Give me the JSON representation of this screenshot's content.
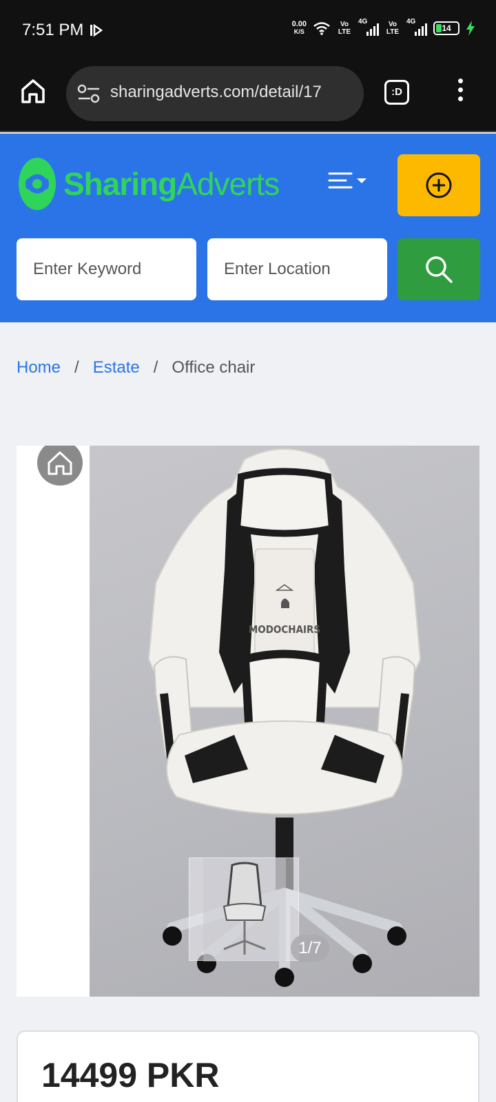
{
  "status_bar": {
    "time": "7:51 PM",
    "speed_value": "0.00",
    "speed_unit": "K/S",
    "volte1": "Vo LTE",
    "net1": "4G",
    "volte2": "Vo LTE",
    "net2": "4G",
    "battery": "14"
  },
  "browser": {
    "url": "sharingadverts.com/detail/17",
    "tab_label": ":D"
  },
  "header": {
    "brand_bold": "Sharing",
    "brand_light": "Adverts",
    "keyword_placeholder": "Enter Keyword",
    "location_placeholder": "Enter Location",
    "brand_color": "#2b74e8",
    "post_button_color": "#fdb900",
    "search_button_color": "#2f9d3f"
  },
  "breadcrumb": {
    "home": "Home",
    "category": "Estate",
    "current": "Office chair",
    "separator": "/"
  },
  "gallery": {
    "counter": "1/7",
    "watermark": "MODOCHAIRS"
  },
  "listing": {
    "price": "14499 PKR"
  }
}
